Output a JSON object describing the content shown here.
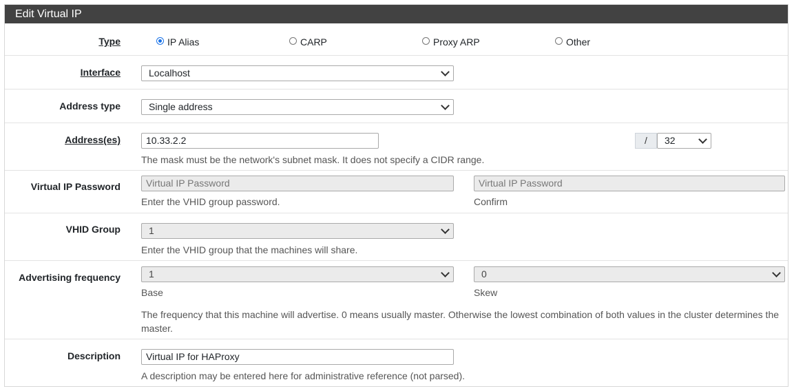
{
  "panel": {
    "title": "Edit Virtual IP"
  },
  "type": {
    "label": "Type",
    "options": [
      {
        "label": "IP Alias",
        "checked": true
      },
      {
        "label": "CARP",
        "checked": false
      },
      {
        "label": "Proxy ARP",
        "checked": false
      },
      {
        "label": "Other",
        "checked": false
      }
    ]
  },
  "interface": {
    "label": "Interface",
    "value": "Localhost"
  },
  "address_type": {
    "label": "Address type",
    "value": "Single address"
  },
  "addresses": {
    "label": "Address(es)",
    "value": "10.33.2.2",
    "slash": "/",
    "mask": "32",
    "help": "The mask must be the network's subnet mask. It does not specify a CIDR range."
  },
  "vip_password": {
    "label": "Virtual IP Password",
    "placeholder": "Virtual IP Password",
    "confirm_placeholder": "Virtual IP Password",
    "help": "Enter the VHID group password.",
    "confirm_help": "Confirm"
  },
  "vhid_group": {
    "label": "VHID Group",
    "value": "1",
    "help": "Enter the VHID group that the machines will share."
  },
  "adv_freq": {
    "label": "Advertising frequency",
    "base_value": "1",
    "skew_value": "0",
    "base_help": "Base",
    "skew_help": "Skew",
    "help": "The frequency that this machine will advertise. 0 means usually master. Otherwise the lowest combination of both values in the cluster determines the master."
  },
  "description": {
    "label": "Description",
    "value": "Virtual IP for HAProxy",
    "help": "A description may be entered here for administrative reference (not parsed)."
  }
}
